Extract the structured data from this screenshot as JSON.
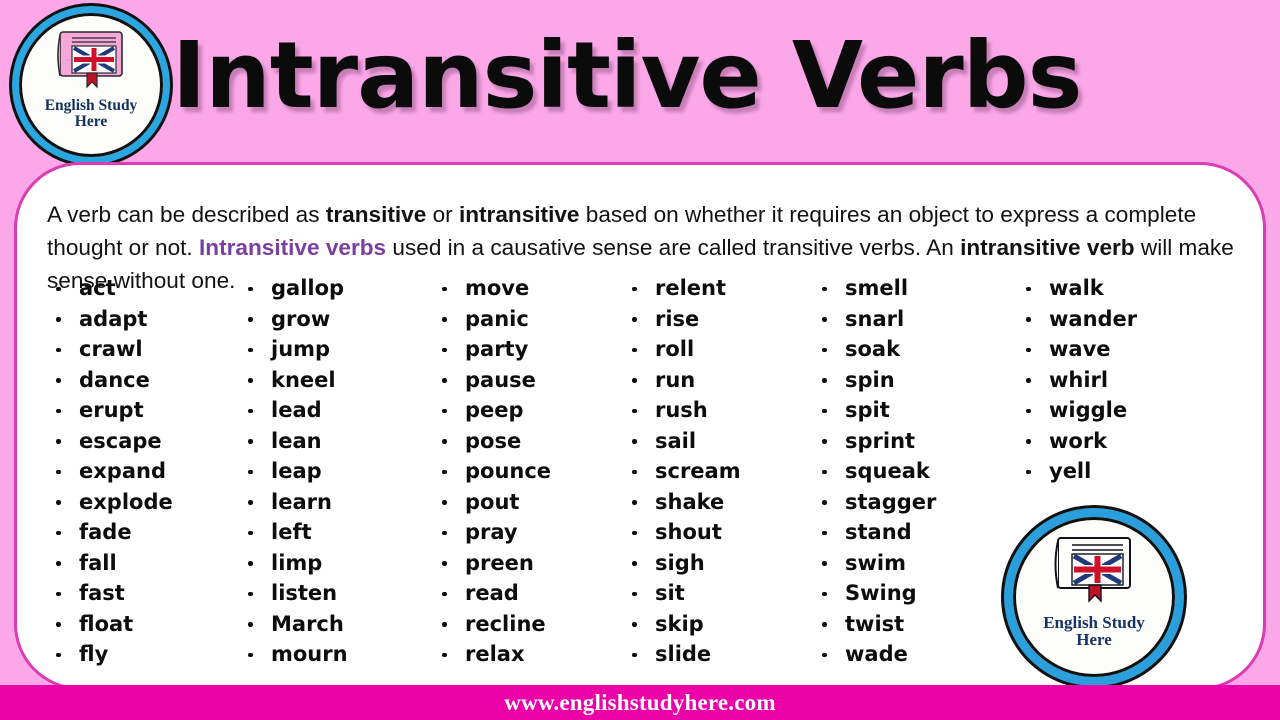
{
  "page": {
    "title": "Intransitive Verbs",
    "background_color": "#fba7e8",
    "card_background": "#ffffff",
    "card_border_color": "#dc3bb4",
    "accent_purple": "#7b3fa0",
    "footer_color": "#ec00a8",
    "logo_ring_color": "#2aa7e0"
  },
  "logo": {
    "line1": "English Study",
    "line2": "Here",
    "icon": "book-uk-flag-icon"
  },
  "intro": {
    "seg1": "A verb can be described as ",
    "bold1": "transitive",
    "seg2": " or ",
    "bold2": "intransitive",
    "seg3": " based on whether it requires an object to express a complete thought or not. ",
    "highlight": "Intransitive verbs",
    "seg4": " used in a causative sense are called transitive verbs. An ",
    "bold3": "intransitive verb",
    "seg5": " will make sense without one."
  },
  "columns": [
    {
      "items": [
        "act",
        "adapt",
        "crawl",
        "dance",
        "erupt",
        "escape",
        "expand",
        "explode",
        "fade",
        "fall",
        "fast",
        "float",
        "fly"
      ]
    },
    {
      "items": [
        "gallop",
        "grow",
        "jump",
        "kneel",
        "lead",
        "lean",
        "leap",
        "learn",
        "left",
        "limp",
        "listen",
        "March",
        "mourn"
      ]
    },
    {
      "items": [
        "move",
        "panic",
        "party",
        "pause",
        "peep",
        "pose",
        "pounce",
        "pout",
        "pray",
        "preen",
        "read",
        "recline",
        "relax"
      ]
    },
    {
      "items": [
        "relent",
        "rise",
        "roll",
        "run",
        "rush",
        "sail",
        "scream",
        "shake",
        "shout",
        "sigh",
        "sit",
        "skip",
        "slide"
      ]
    },
    {
      "items": [
        "smell",
        "snarl",
        "soak",
        "spin",
        "spit",
        "sprint",
        "squeak",
        "stagger",
        "stand",
        "swim",
        "Swing",
        "twist",
        "wade"
      ]
    },
    {
      "items": [
        "walk",
        "wander",
        "wave",
        "whirl",
        "wiggle",
        "work",
        "yell"
      ]
    }
  ],
  "footer": {
    "url": "www.englishstudyhere.com"
  }
}
